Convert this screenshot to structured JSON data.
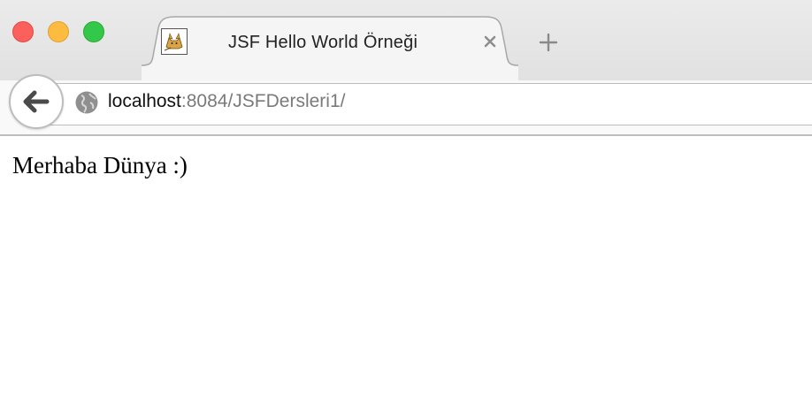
{
  "window": {
    "controls": [
      "close",
      "minimize",
      "maximize"
    ]
  },
  "tab": {
    "title": "JSF Hello World Örneği",
    "favicon": "tomcat-icon",
    "close_icon": "close-icon"
  },
  "new_tab_icon": "plus-icon",
  "navigation": {
    "back_icon": "back-arrow-icon",
    "site_icon": "globe-icon",
    "url_host": "localhost",
    "url_path": ":8084/JSFDersleri1/"
  },
  "page": {
    "text": "Merhaba Dünya :)"
  },
  "colors": {
    "close": "#fc605c",
    "minimize": "#fdbc40",
    "maximize": "#34c84a"
  }
}
